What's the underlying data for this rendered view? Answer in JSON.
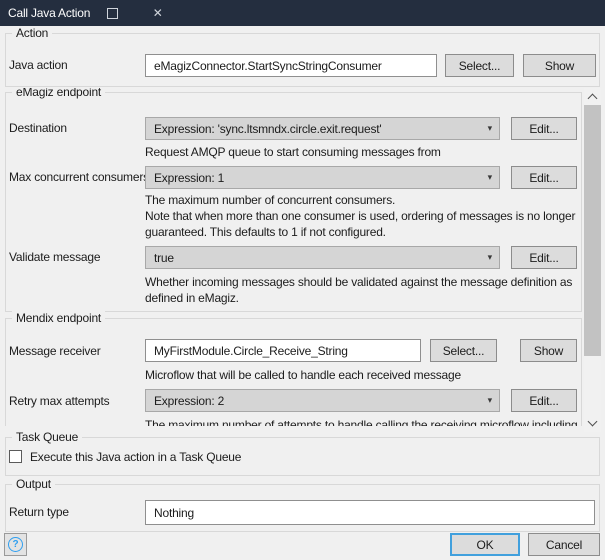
{
  "window": {
    "title": "Call Java Action"
  },
  "icons": {
    "close": "✕",
    "dropdown_arrow": "▾",
    "help": "?"
  },
  "colors": {
    "titlebar": "#242e3f",
    "accent_blue": "#41a0dd",
    "help_blue": "#2f9ff0",
    "body_bg": "#f0f0f0"
  },
  "sections": {
    "action": {
      "title": "Action",
      "java_action": {
        "label": "Java action",
        "value": "eMagizConnector.StartSyncStringConsumer",
        "select_button": "Select...",
        "show_button": "Show"
      }
    },
    "emagiz_endpoint": {
      "title": "eMagiz endpoint",
      "destination": {
        "label": "Destination",
        "value": "Expression: 'sync.ltsmndx.circle.exit.request'",
        "edit_button": "Edit...",
        "help": "Request AMQP queue to start consuming messages from"
      },
      "max_concurrent_consumers": {
        "label": "Max concurrent consumers",
        "value": "Expression: 1",
        "edit_button": "Edit...",
        "help_line1": "The maximum number of concurrent consumers.",
        "help_line2": "Note that when more than one consumer is used, ordering of messages is no longer guaranteed. This defaults to 1 if not configured."
      },
      "validate_message": {
        "label": "Validate message",
        "value": "true",
        "edit_button": "Edit...",
        "help": "Whether incoming messages should be validated against the message definition as defined in eMagiz."
      }
    },
    "mendix_endpoint": {
      "title": "Mendix endpoint",
      "message_receiver": {
        "label": "Message receiver",
        "value": "MyFirstModule.Circle_Receive_String",
        "select_button": "Select...",
        "show_button": "Show",
        "help": "Microflow that will be called to handle each received message"
      },
      "retry_max_attempts": {
        "label": "Retry max attempts",
        "value": "Expression: 2",
        "edit_button": "Edit...",
        "help_clipped": "The maximum number of attempts to handle calling the receiving microflow including the first attempt."
      }
    },
    "task_queue": {
      "title": "Task Queue",
      "checkbox_label": "Execute this Java action in a Task Queue",
      "checked": false
    },
    "output": {
      "title": "Output",
      "return_type": {
        "label": "Return type",
        "value": "Nothing"
      }
    }
  },
  "footer": {
    "ok_button": "OK",
    "cancel_button": "Cancel"
  }
}
